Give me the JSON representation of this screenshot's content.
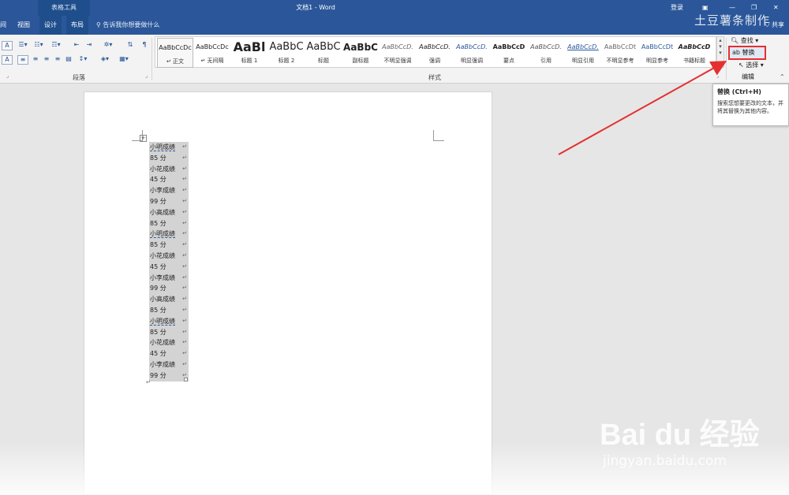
{
  "titlebar": {
    "context_tab": "表格工具",
    "doc_title": "文档1  -  Word",
    "login": "登录"
  },
  "tabs": [
    {
      "label": "间"
    },
    {
      "label": "视图"
    },
    {
      "label": "设计"
    },
    {
      "label": "布局"
    }
  ],
  "tell_me": "告诉我你想要做什么",
  "share": "共享",
  "groups": {
    "paragraph": "段落",
    "styles": "样式",
    "editing": "编辑"
  },
  "styles": [
    {
      "preview": "AaBbCcDc",
      "label": "↵ 正文"
    },
    {
      "preview": "AaBbCcDc",
      "label": "↵ 无间隔"
    },
    {
      "preview": "AaBl",
      "label": "标题 1"
    },
    {
      "preview": "AaBbC",
      "label": "标题 2"
    },
    {
      "preview": "AaBbC",
      "label": "标题"
    },
    {
      "preview": "AaBbC",
      "label": "副标题"
    },
    {
      "preview": "AaBbCcD.",
      "label": "不明显强调"
    },
    {
      "preview": "AaBbCcD.",
      "label": "强调"
    },
    {
      "preview": "AaBbCcD.",
      "label": "明显强调"
    },
    {
      "preview": "AaBbCcD",
      "label": "要点"
    },
    {
      "preview": "AaBbCcD.",
      "label": "引用"
    },
    {
      "preview": "AaBbCcD.",
      "label": "明显引用"
    },
    {
      "preview": "AaBbCcDt",
      "label": "不明显参考"
    },
    {
      "preview": "AaBbCcDt",
      "label": "明显参考"
    },
    {
      "preview": "AaBbCcD",
      "label": "书籍标题"
    }
  ],
  "editing": {
    "find": "查找",
    "replace": "替换",
    "select": "选择"
  },
  "tooltip": {
    "title": "替换 (Ctrl+H)",
    "body": "搜索您想要更改的文本，并将其替换为其他内容。"
  },
  "table_rows": [
    "小明成绩",
    "85 分",
    "小花成绩",
    "45 分",
    "小李成绩",
    "99 分",
    "小高成绩",
    "85 分",
    "小明成绩",
    "85 分",
    "小花成绩",
    "45 分",
    "小李成绩",
    "99 分",
    "小高成绩",
    "85 分",
    "小明成绩",
    "85 分",
    "小花成绩",
    "45 分",
    "小李成绩",
    "99 分"
  ],
  "watermark": "土豆薯条制作",
  "baidu": {
    "logo": "Bai du 经验",
    "url": "jingyan.baidu.com"
  },
  "colors": {
    "accent": "#2b579a",
    "highlight": "#e53030"
  }
}
